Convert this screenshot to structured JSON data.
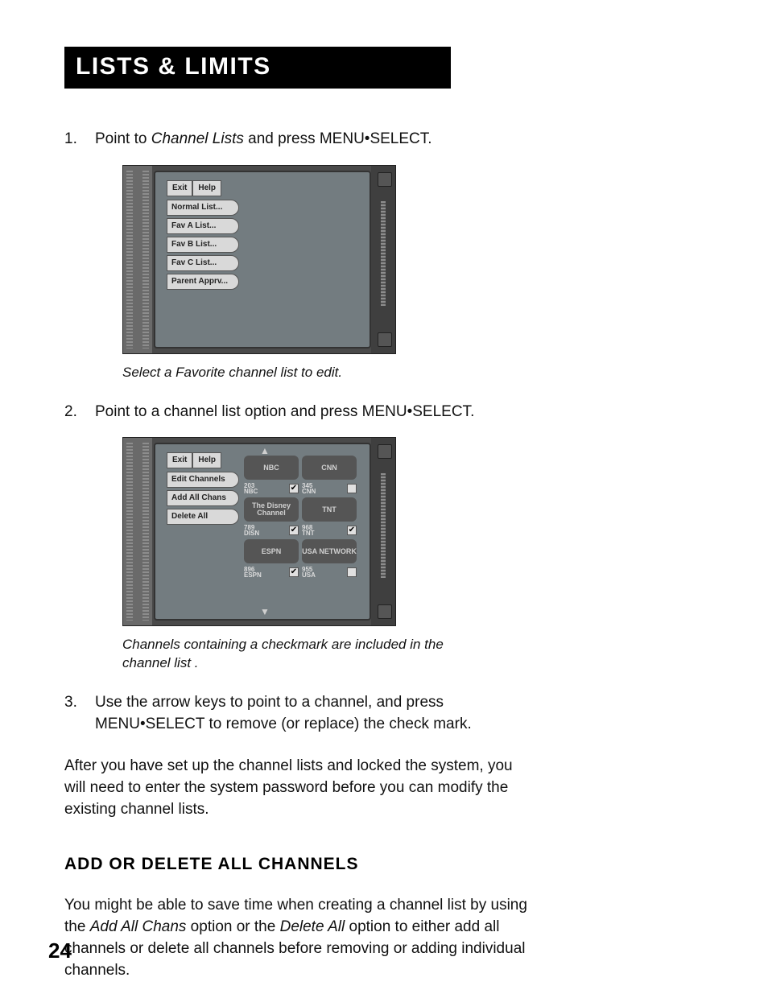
{
  "header": {
    "title": "Lists & Limits"
  },
  "steps": {
    "s1": {
      "pre": "Point to ",
      "em": "Channel Lists",
      "mid": " and press ",
      "cmd": "MENU•SELECT",
      "post": "."
    },
    "s2": {
      "pre": "Point to a channel list option and press ",
      "cmd": "MENU•SELECT",
      "post": "."
    },
    "s3": {
      "line1_pre": "Use the arrow keys to point to a channel, and press",
      "line2_cmd": "MENU•SELECT",
      "line2_post": " to remove (or replace) the check mark."
    }
  },
  "caption1": "Select a Favorite channel list to edit.",
  "caption2": "Channels containing a checkmark are included in the channel list .",
  "screen1": {
    "tabs": {
      "exit": "Exit",
      "help": "Help"
    },
    "items": [
      "Normal List...",
      "Fav A List...",
      "Fav B List...",
      "Fav C List...",
      "Parent Apprv..."
    ]
  },
  "screen2": {
    "tabs": {
      "exit": "Exit",
      "help": "Help"
    },
    "items": [
      "Edit Channels",
      "Add All Chans",
      "Delete All"
    ],
    "channels": [
      {
        "logo": "NBC",
        "num": "203",
        "code": "NBC",
        "checked": true
      },
      {
        "logo": "CNN",
        "num": "345",
        "code": "CNN",
        "checked": false
      },
      {
        "logo": "The Disney Channel",
        "num": "789",
        "code": "DISN",
        "checked": true
      },
      {
        "logo": "TNT",
        "num": "968",
        "code": "TNT",
        "checked": true
      },
      {
        "logo": "ESPN",
        "num": "896",
        "code": "ESPN",
        "checked": true
      },
      {
        "logo": "USA NETWORK",
        "num": "955",
        "code": "USA",
        "checked": false
      }
    ]
  },
  "after_para": "After you have set up the channel lists and locked the system, you will need to enter the system password before you can modify the existing channel lists.",
  "subhead": "Add or Delete All Channels",
  "sub_para": {
    "p1": "You might be able to save time when creating a channel list by using the ",
    "em1": "Add All Chans",
    "p2": " option or the ",
    "em2": "Delete All",
    "p3": " option to either add all channels or delete all channels before removing or adding individual channels."
  },
  "page_number": "24"
}
